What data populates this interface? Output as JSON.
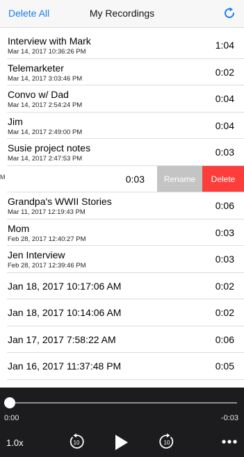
{
  "header": {
    "left_label": "Delete All",
    "title": "My Recordings",
    "right_icon": "refresh-icon",
    "accent_color": "#1a7cf0"
  },
  "recordings": [
    {
      "name": "Interview with Mark",
      "date": "Mar 14, 2017 10:36:26 PM",
      "duration": "1:04"
    },
    {
      "name": "Telemarketer",
      "date": "Mar 14, 2017 3:03:46 PM",
      "duration": "0:02"
    },
    {
      "name": "Convo w/ Dad",
      "date": "Mar 14, 2017 2:54:24 PM",
      "duration": "0:04"
    },
    {
      "name": "Jim",
      "date": "Mar 14, 2017 2:49:00 PM",
      "duration": "0:04"
    },
    {
      "name": "Susie project notes",
      "date": "Mar 14, 2017 2:47:53 PM",
      "duration": "0:03"
    }
  ],
  "swiped_row": {
    "stub_text": "M",
    "duration": "0:03",
    "rename_label": "Rename",
    "delete_label": "Delete",
    "rename_color": "#c4c4c4",
    "delete_color": "#fc3d39"
  },
  "recordings_more": [
    {
      "name": "Grandpa's WWII Stories",
      "date": "Mar 11, 2017 12:19:43 PM",
      "duration": "0:06"
    },
    {
      "name": "Mom",
      "date": "Feb 28, 2017 12:40:27 PM",
      "duration": "0:03"
    },
    {
      "name": "Jen Interview",
      "date": "Feb 28, 2017 12:39:46 PM",
      "duration": "0:03"
    }
  ],
  "recordings_untitled": [
    {
      "name": "Jan 18, 2017 10:17:06 AM",
      "duration": "0:02"
    },
    {
      "name": "Jan 18, 2017 10:14:06 AM",
      "duration": "0:02"
    },
    {
      "name": "Jan 17, 2017 7:58:22 AM",
      "duration": "0:06"
    },
    {
      "name": "Jan 16, 2017 11:37:48 PM",
      "duration": "0:05"
    }
  ],
  "player": {
    "elapsed": "0:00",
    "remaining": "-0:03",
    "progress": 0,
    "speed": "1.0x",
    "skip_seconds": "10",
    "background": "#1c1c1e",
    "icons": [
      "skip-back-10-icon",
      "play-icon",
      "skip-forward-10-icon",
      "more-icon"
    ]
  }
}
